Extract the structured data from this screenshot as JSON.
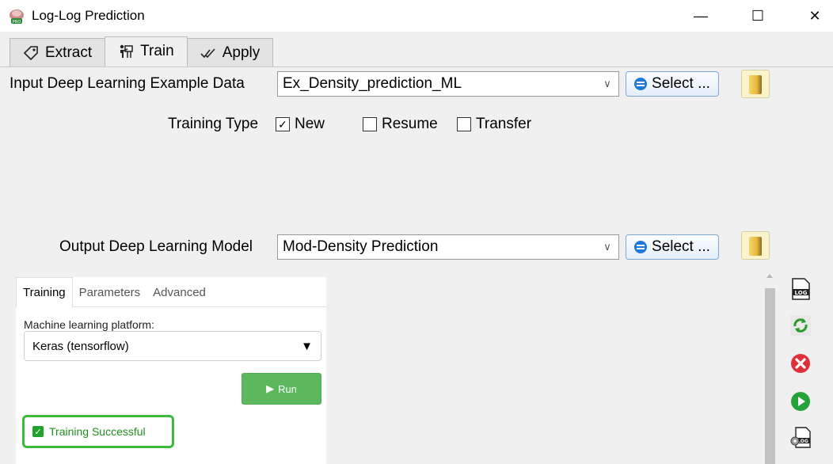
{
  "window": {
    "title": "Log-Log Prediction",
    "icon": "app-logo-pro-icon",
    "minimize": "—",
    "maximize": "☐",
    "close": "✕"
  },
  "main_tabs": [
    {
      "label": "Extract",
      "icon": "tag-icon",
      "active": false
    },
    {
      "label": "Train",
      "icon": "train-icon",
      "active": true
    },
    {
      "label": "Apply",
      "icon": "double-check-icon",
      "active": false
    }
  ],
  "input": {
    "label": "Input Deep Learning Example Data",
    "value": "Ex_Density_prediction_ML",
    "select_label": "Select ..."
  },
  "training_type": {
    "label": "Training Type",
    "options": [
      {
        "label": "New",
        "checked": true
      },
      {
        "label": "Resume",
        "checked": false
      },
      {
        "label": "Transfer",
        "checked": false
      }
    ]
  },
  "output": {
    "label": "Output Deep Learning Model",
    "value": "Mod-Density Prediction",
    "select_label": "Select ..."
  },
  "panel": {
    "tabs": [
      "Training",
      "Parameters",
      "Advanced"
    ],
    "active_tab": "Training",
    "platform_label": "Machine learning platform:",
    "platform_value": "Keras (tensorflow)",
    "run_label": "Run",
    "status_text": "Training Successful"
  },
  "toolbar": [
    "log-file-icon",
    "refresh-icon",
    "stop-icon",
    "play-icon",
    "log-settings-icon"
  ],
  "colors": {
    "success_green": "#3cb93c",
    "run_green": "#5cb85c",
    "select_blue": "#1e7ad6"
  }
}
